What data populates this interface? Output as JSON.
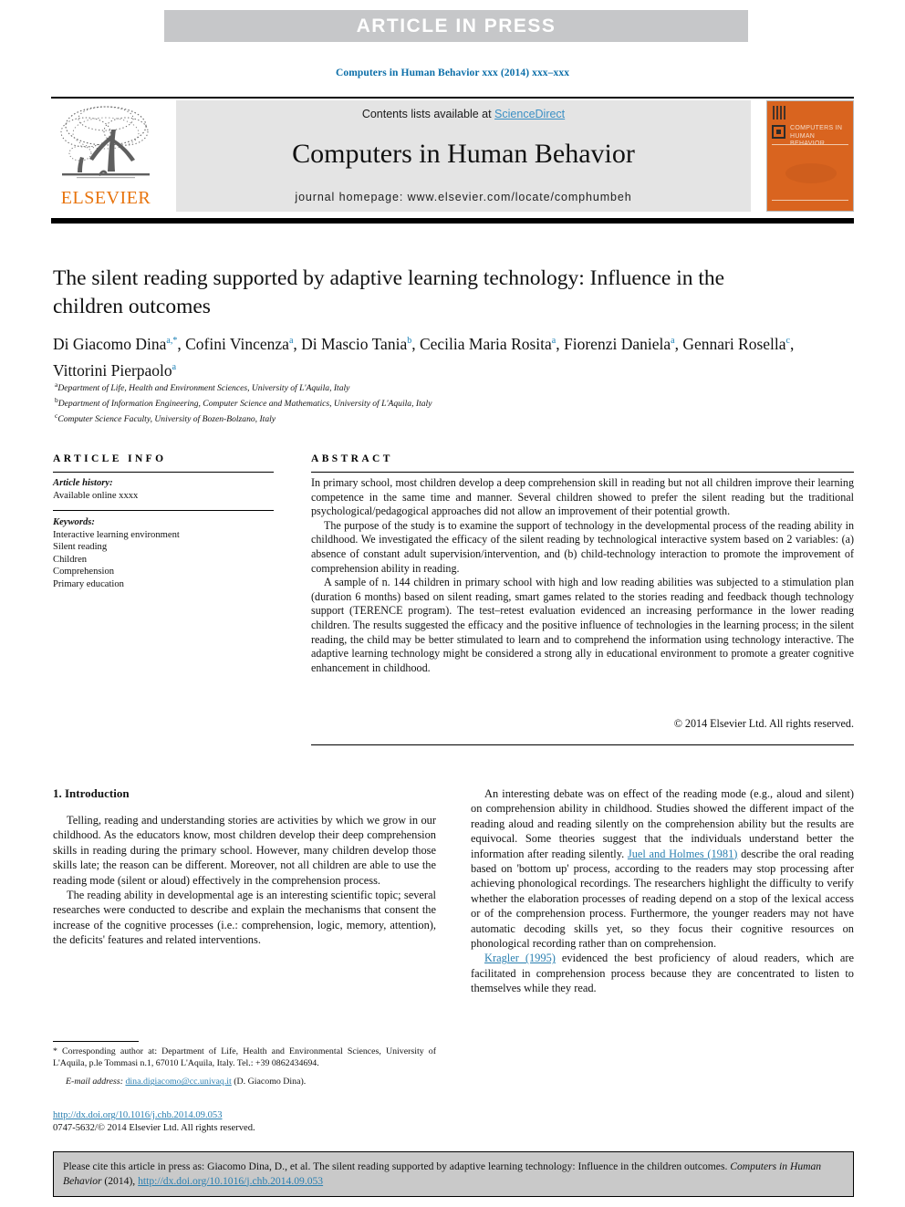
{
  "banner": {
    "text": "ARTICLE  IN  PRESS",
    "bg_color": "#c6c7c9",
    "text_color": "#ffffff"
  },
  "running_head": "Computers in Human Behavior xxx (2014) xxx–xxx",
  "masthead": {
    "contents_prefix": "Contents lists available at ",
    "sciencedirect": "ScienceDirect",
    "journal_title": "Computers in Human Behavior",
    "journal_homepage": "journal homepage: www.elsevier.com/locate/comphumbeh",
    "publisher": "ELSEVIER",
    "publisher_color": "#e8730c",
    "cover_title": "COMPUTERS IN HUMAN BEHAVIOR",
    "cover_color": "#d9641f",
    "link_color": "#3a8fc4"
  },
  "article": {
    "title": "The silent reading supported by adaptive learning technology: Influence in the children outcomes",
    "authors_line1_a": "Di Giacomo Dina",
    "authors_sup1": "a,*",
    "authors_line1_b": ", Cofini Vincenza",
    "authors_sup2": "a",
    "authors_line1_c": ", Di Mascio Tania",
    "authors_sup3": "b",
    "authors_line1_d": ", Cecilia Maria Rosita",
    "authors_sup4": "a",
    "authors_line1_e": ", Fiorenzi Daniela",
    "authors_sup5": "a",
    "authors_line2_a": ", Gennari Rosella",
    "authors_sup6": "c",
    "authors_line2_b": ", Vittorini Pierpaolo",
    "authors_sup7": "a",
    "affiliations": [
      {
        "mark": "a",
        "text": "Department of Life, Health and Environment Sciences, University of L'Aquila, Italy"
      },
      {
        "mark": "b",
        "text": "Department of Information Engineering, Computer Science and Mathematics, University of L'Aquila, Italy"
      },
      {
        "mark": "c",
        "text": "Computer Science Faculty, University of Bozen-Bolzano, Italy"
      }
    ]
  },
  "article_info": {
    "heading": "ARTICLE INFO",
    "history_label": "Article history:",
    "history_value": "Available online xxxx",
    "keywords_label": "Keywords:",
    "keywords": [
      "Interactive learning environment",
      "Silent reading",
      "Children",
      "Comprehension",
      "Primary education"
    ]
  },
  "abstract": {
    "heading": "ABSTRACT",
    "paragraphs": [
      "In primary school, most children develop a deep comprehension skill in reading but not all children improve their learning competence in the same time and manner. Several children showed to prefer the silent reading but the traditional psychological/pedagogical approaches did not allow an improvement of their potential growth.",
      "The purpose of the study is to examine the support of technology in the developmental process of the reading ability in childhood. We investigated the efficacy of the silent reading by technological interactive system based on 2 variables: (a) absence of constant adult supervision/intervention, and (b) child-technology interaction to promote the improvement of comprehension ability in reading.",
      "A sample of n. 144 children in primary school with high and low reading abilities was subjected to a stimulation plan (duration 6 months) based on silent reading, smart games related to the stories reading and feedback though technology support (TERENCE program). The test–retest evaluation evidenced an increasing performance in the lower reading children. The results suggested the efficacy and the positive influence of technologies in the learning process; in the silent reading, the child may be better stimulated to learn and to comprehend the information using technology interactive. The adaptive learning technology might be considered a strong ally in educational environment to promote a greater cognitive enhancement in childhood."
    ],
    "copyright": "© 2014 Elsevier Ltd. All rights reserved."
  },
  "body": {
    "section_heading": "1. Introduction",
    "left_paragraphs": [
      "Telling, reading and understanding stories are activities by which we grow in our childhood. As the educators know, most children develop their deep comprehension skills in reading during the primary school. However, many children develop those skills late; the reason can be different. Moreover, not all children are able to use the reading mode (silent or aloud) effectively in the comprehension process.",
      "The reading ability in developmental age is an interesting scientific topic; several researches were conducted to describe and explain the mechanisms that consent the increase of the cognitive processes (i.e.: comprehension, logic, memory, attention), the deficits' features and related interventions."
    ],
    "right_paragraph_1_pre": "An interesting debate was on effect of the reading mode (e.g., aloud and silent) on comprehension ability in childhood. Studies showed the different impact of the reading aloud and reading silently on the comprehension ability but the results are equivocal. Some theories suggest that the individuals understand better the information after reading silently. ",
    "right_citation_1": "Juel and Holmes (1981)",
    "right_paragraph_1_post": " describe the oral reading based on 'bottom up' process, according to the readers may stop processing after achieving phonological recordings. The researchers highlight the difficulty to verify whether the elaboration processes of reading depend on a stop of the lexical access or of the comprehension process. Furthermore, the younger readers may not have automatic decoding skills yet, so they focus their cognitive resources on phonological recording rather than on comprehension.",
    "right_citation_2": "Kragler (1995)",
    "right_paragraph_2_post": " evidenced the best proficiency of aloud readers, which are facilitated in comprehension process because they are concentrated to listen to themselves while they read.",
    "citation_color": "#2a7fb0"
  },
  "footnotes": {
    "corresponding": "* Corresponding author at: Department of Life, Health and Environmental Sciences, University of L'Aquila, p.le Tommasi n.1, 67010 L'Aquila, Italy. Tel.: +39 0862434694.",
    "email_label": "E-mail address:",
    "email_value": "dina.digiacomo@cc.univaq.it",
    "email_suffix": " (D. Giacomo Dina)."
  },
  "doi_block": {
    "doi_url": "http://dx.doi.org/10.1016/j.chb.2014.09.053",
    "issn_line": "0747-5632/© 2014 Elsevier Ltd. All rights reserved."
  },
  "cite_box": {
    "prefix": "Please cite this article in press as: Giacomo Dina, D., et al. The silent reading supported by adaptive learning technology: Influence in the children outcomes. ",
    "journal": "Computers in Human Behavior",
    "year": " (2014), ",
    "doi": "http://dx.doi.org/10.1016/j.chb.2014.09.053",
    "bg_color": "#c9c9c9"
  }
}
